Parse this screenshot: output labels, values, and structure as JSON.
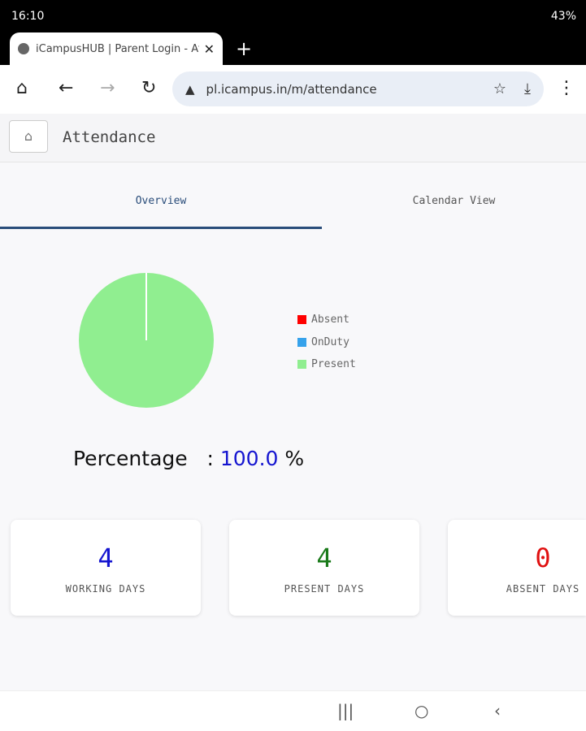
{
  "status": {
    "time": "16:10",
    "battery": "43%"
  },
  "browser": {
    "tab_title": "iCampusHUB | Parent Login - Att",
    "url": "pl.icampus.in/m/attendance"
  },
  "app": {
    "title": "Attendance",
    "tabs": [
      {
        "label": "Overview",
        "active": true
      },
      {
        "label": "Calendar View",
        "active": false
      }
    ]
  },
  "chart_data": {
    "type": "pie",
    "categories": [
      "Absent",
      "OnDuty",
      "Present"
    ],
    "values": [
      0,
      0,
      4
    ],
    "colors": [
      "#ff0000",
      "#36a2eb",
      "#90ee90"
    ],
    "legend": "right"
  },
  "percentage": {
    "label": "Percentage",
    "sep": ":",
    "value": "100.0",
    "unit": "%"
  },
  "cards": [
    {
      "value": "4",
      "label": "WORKING DAYS",
      "color": "#1515d0"
    },
    {
      "value": "4",
      "label": "PRESENT DAYS",
      "color": "#1a7a1a"
    },
    {
      "value": "0",
      "label": "ABSENT DAYS",
      "color": "#e01010"
    }
  ]
}
